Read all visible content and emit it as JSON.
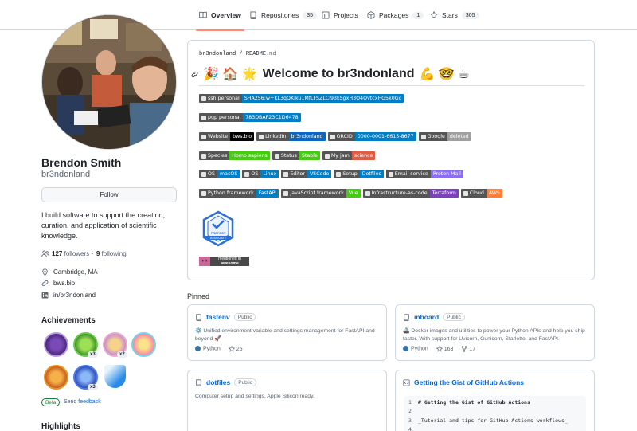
{
  "nav": {
    "tabs": [
      {
        "label": "Overview",
        "count": null,
        "icon": "book-icon"
      },
      {
        "label": "Repositories",
        "count": "35",
        "icon": "repo-icon"
      },
      {
        "label": "Projects",
        "count": null,
        "icon": "table-icon"
      },
      {
        "label": "Packages",
        "count": "1",
        "icon": "package-icon"
      },
      {
        "label": "Stars",
        "count": "305",
        "icon": "star-icon"
      }
    ]
  },
  "profile": {
    "name": "Brendon Smith",
    "login": "br3ndonland",
    "follow_label": "Follow",
    "bio": "I build software to support the creation, curation, and application of scientific knowledge.",
    "followers": "127",
    "followers_label": "followers",
    "separator": "·",
    "following": "9",
    "following_label": "following",
    "location": "Cambridge, MA",
    "website": "bws.bio",
    "linkedin": "in/br3ndonland"
  },
  "achievements": {
    "title": "Achievements",
    "counts": [
      "x3",
      "x2",
      "x3"
    ],
    "beta_label": "Beta",
    "feedback_label": "Send feedback"
  },
  "highlights_title": "Highlights",
  "readme": {
    "owner": "br3ndonland",
    "slash": "/",
    "file": "README",
    "ext": ".md",
    "title": "Welcome to br3ndonland",
    "emoji_left": "🎉 🏠 🌟",
    "emoji_right": "💪 🤓 ☕",
    "badge_rows": [
      [
        {
          "l": "ssh personal",
          "r": "SHA256:w+KL3qQKIku1MfLFSZLCl93kSgxH3O4OvtcxHG5k0Go",
          "c": "#007ec6"
        }
      ],
      [
        {
          "l": "pgp personal",
          "r": "783DBAF23C1D6478",
          "c": "#007ec6"
        }
      ],
      [
        {
          "l": "Website",
          "r": "bws.bio",
          "c": "#000000"
        },
        {
          "l": "LinkedIn",
          "r": "br3ndonland",
          "c": "#0a66c2"
        },
        {
          "l": "ORCID",
          "r": "0000-0001-6615-8677",
          "c": "#007ec6"
        },
        {
          "l": "Google",
          "r": "deleted",
          "c": "#9f9f9f"
        }
      ],
      [
        {
          "l": "Species",
          "r": "Homo sapiens",
          "c": "#4c1"
        },
        {
          "l": "Status",
          "r": "Stable",
          "c": "#4c1"
        },
        {
          "l": "My jam",
          "r": "science",
          "c": "#e05d44"
        }
      ],
      [
        {
          "l": "OS",
          "r": "macOS",
          "c": "#007ec6"
        },
        {
          "l": "OS",
          "r": "Linux",
          "c": "#007ec6"
        },
        {
          "l": "Editor",
          "r": "VSCode",
          "c": "#007ec6"
        },
        {
          "l": "Setup",
          "r": "Dotfiles",
          "c": "#007ec6"
        },
        {
          "l": "Email service",
          "r": "Proton Mail",
          "c": "#8b6ef5"
        }
      ],
      [
        {
          "l": "Python framework",
          "r": "FastAPI",
          "c": "#007ec6"
        },
        {
          "l": "JavaScript framework",
          "r": "Vue",
          "c": "#4c1"
        },
        {
          "l": "Infrastructure-as-code",
          "r": "Terraform",
          "c": "#7b42bc"
        },
        {
          "l": "Cloud",
          "r": "AWS",
          "c": "#fe7d37"
        }
      ]
    ],
    "cert_text": [
      "PREFECT",
      "ASSOCIATE"
    ],
    "awesome_text": [
      "mentioned in",
      "awesome"
    ]
  },
  "pinned": {
    "title": "Pinned",
    "public_label": "Public",
    "cards": [
      {
        "repo": "fastenv",
        "desc": "⚙️ Unified environment variable and settings management for FastAPI and beyond 🚀",
        "lang": "Python",
        "stars": "25",
        "forks": null
      },
      {
        "repo": "inboard",
        "desc": "🚢 Docker images and utilities to power your Python APIs and help you ship faster. With support for Uvicorn, Gunicorn, Starlette, and FastAPI.",
        "lang": "Python",
        "stars": "163",
        "forks": "17"
      },
      {
        "repo": "dotfiles",
        "desc": "Computer setup and settings. Apple Silicon ready.",
        "lang": null,
        "stars": null,
        "forks": null
      },
      {
        "repo": "Getting the Gist of GitHub Actions",
        "code_lines": [
          {
            "n": "1",
            "t": "# Getting the Gist of GitHub Actions"
          },
          {
            "n": "2",
            "t": ""
          },
          {
            "n": "3",
            "t": "_Tutorial and tips for GitHub Actions workflows_"
          },
          {
            "n": "4",
            "t": ""
          }
        ]
      }
    ]
  },
  "colors": {
    "accent": "#fd8c73",
    "link": "#0969da",
    "border": "#d0d7de"
  }
}
